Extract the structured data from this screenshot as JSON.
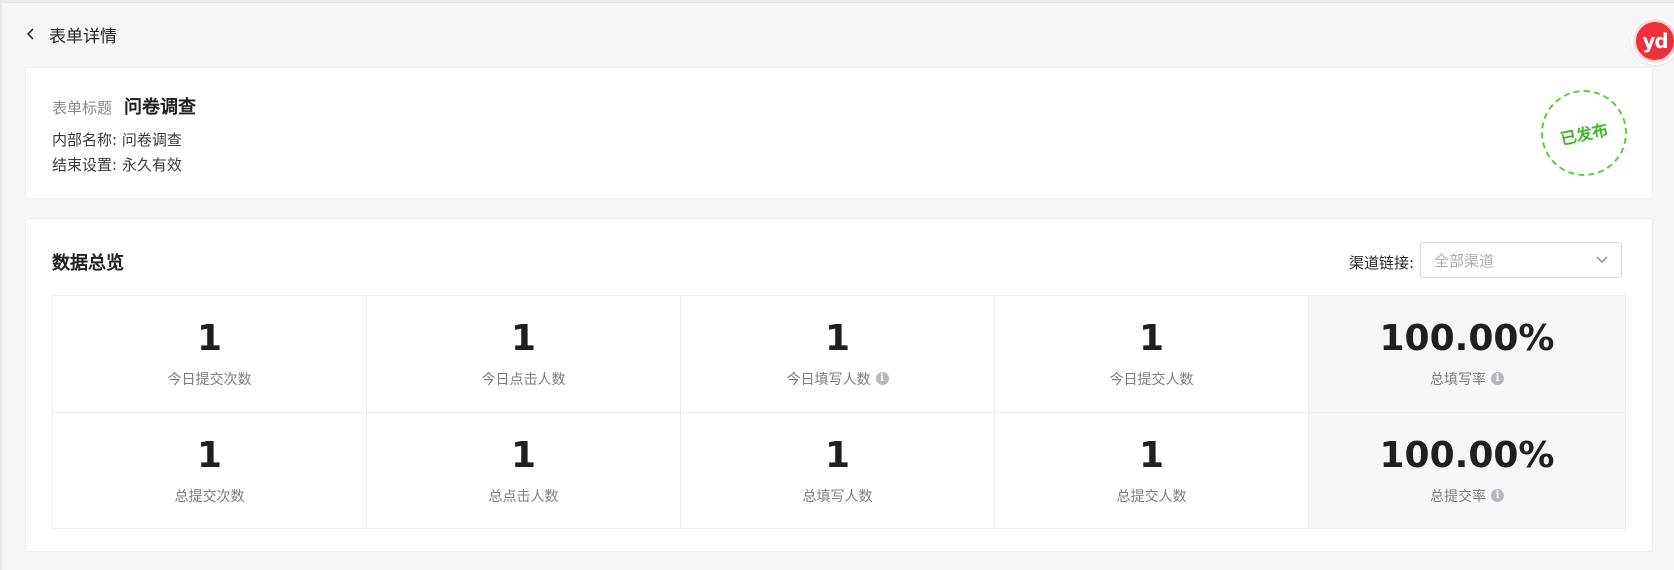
{
  "header": {
    "back_title": "表单详情"
  },
  "floating_badge": {
    "text": "yd",
    "color": "#ee2f3c"
  },
  "form_info": {
    "title_label": "表单标题",
    "title_value": "问卷调查",
    "internal_name": "内部名称: 问卷调查",
    "end_setting": "结束设置: 永久有效",
    "status_stamp": "已发布",
    "status_color": "#3fb626"
  },
  "overview": {
    "title": "数据总览",
    "channel_label": "渠道链接:",
    "channel_placeholder": "全部渠道",
    "rows": [
      [
        {
          "value": "1",
          "label": "今日提交次数",
          "info": false
        },
        {
          "value": "1",
          "label": "今日点击人数",
          "info": false
        },
        {
          "value": "1",
          "label": "今日填写人数",
          "info": true
        },
        {
          "value": "1",
          "label": "今日提交人数",
          "info": false
        },
        {
          "value": "100.00%",
          "label": "总填写率",
          "info": true
        }
      ],
      [
        {
          "value": "1",
          "label": "总提交次数",
          "info": false
        },
        {
          "value": "1",
          "label": "总点击人数",
          "info": false
        },
        {
          "value": "1",
          "label": "总填写人数",
          "info": false
        },
        {
          "value": "1",
          "label": "总提交人数",
          "info": false
        },
        {
          "value": "100.00%",
          "label": "总提交率",
          "info": true
        }
      ]
    ]
  },
  "icons": {
    "info": "i",
    "back": "chevron-left-icon",
    "dropdown": "chevron-down-icon"
  }
}
